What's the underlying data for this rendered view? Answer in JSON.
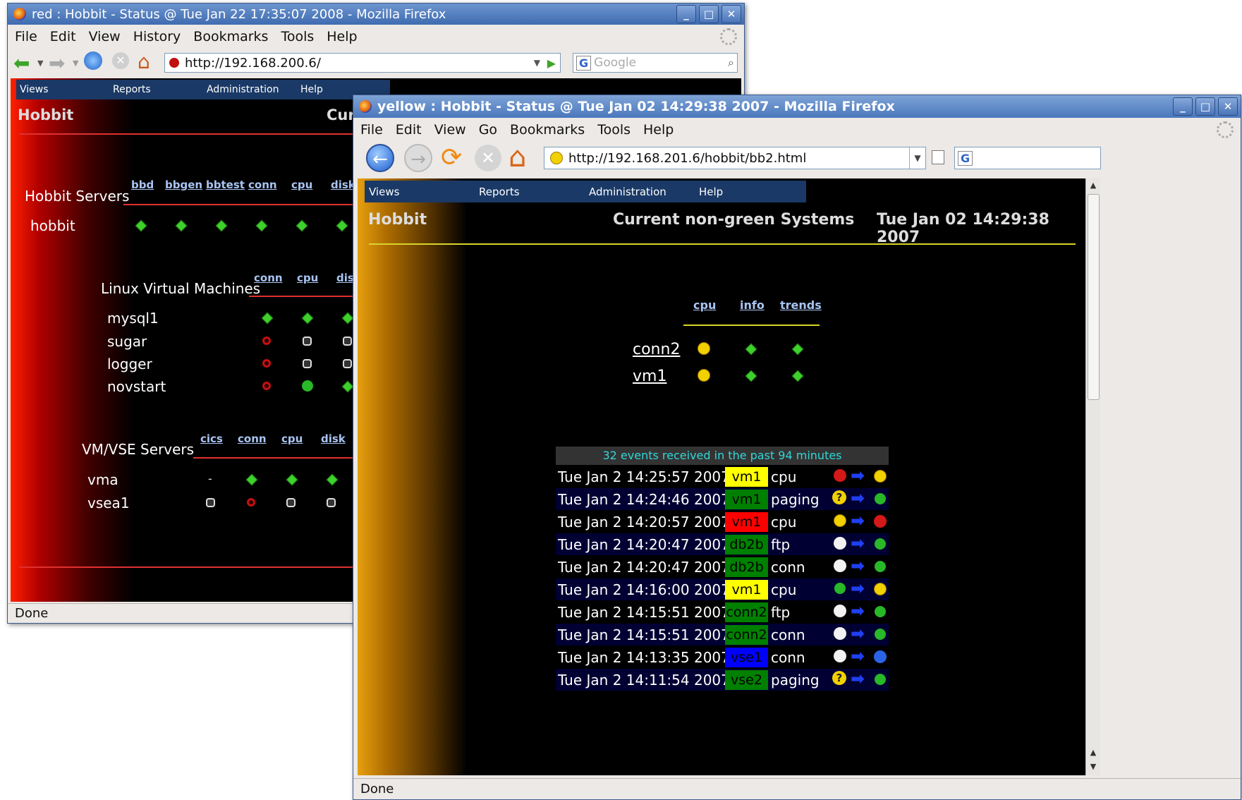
{
  "back_window": {
    "title": "red : Hobbit - Status @ Tue Jan 22 17:35:07 2008 - Mozilla Firefox",
    "menu": [
      "File",
      "Edit",
      "View",
      "History",
      "Bookmarks",
      "Tools",
      "Help"
    ],
    "url": "http://192.168.200.6/",
    "search_placeholder": "Google",
    "status": "Done",
    "page": {
      "menu": [
        "Views",
        "Reports",
        "Administration",
        "Help"
      ],
      "logo": "Hobbit",
      "title_partial": "Curr",
      "groups": [
        {
          "title": "Hobbit Servers",
          "columns": [
            "bbd",
            "bbgen",
            "bbtest",
            "conn",
            "cpu",
            "disk"
          ],
          "rows": [
            {
              "host": "hobbit",
              "states": [
                "green",
                "green",
                "green",
                "green",
                "green",
                "green"
              ]
            }
          ]
        },
        {
          "title": "Linux Virtual Machines",
          "columns": [
            "conn",
            "cpu",
            "disk"
          ],
          "rows": [
            {
              "host": "mysql1",
              "states": [
                "green",
                "green",
                "green"
              ]
            },
            {
              "host": "sugar",
              "states": [
                "red",
                "clear",
                "clear"
              ]
            },
            {
              "host": "logger",
              "states": [
                "red",
                "clear",
                "clear"
              ]
            },
            {
              "host": "novstart",
              "states": [
                "red",
                "green-face",
                "green"
              ]
            }
          ]
        },
        {
          "title": "VM/VSE Servers",
          "columns": [
            "cics",
            "conn",
            "cpu",
            "disk"
          ],
          "rows": [
            {
              "host": "vma",
              "states": [
                "-",
                "green",
                "green",
                "green"
              ]
            },
            {
              "host": "vsea1",
              "states": [
                "clear",
                "red",
                "clear",
                "clear"
              ]
            }
          ]
        }
      ]
    }
  },
  "front_window": {
    "title": "yellow : Hobbit - Status @ Tue Jan 02 14:29:38 2007 - Mozilla Firefox",
    "menu": [
      "File",
      "Edit",
      "View",
      "Go",
      "Bookmarks",
      "Tools",
      "Help"
    ],
    "url": "http://192.168.201.6/hobbit/bb2.html",
    "status": "Done",
    "page": {
      "menu": [
        "Views",
        "Reports",
        "Administration",
        "Help"
      ],
      "logo": "Hobbit",
      "page_title": "Current non-green Systems",
      "timestamp": "Tue Jan 02 14:29:38 2007",
      "columns": [
        "cpu",
        "info",
        "trends"
      ],
      "hosts": [
        {
          "name": "conn2",
          "states": [
            "yellow",
            "green",
            "green"
          ]
        },
        {
          "name": "vm1",
          "states": [
            "yellow",
            "green",
            "green"
          ]
        }
      ],
      "events_header": "32 events received in the past 94 minutes",
      "events": [
        {
          "time": "Tue Jan 2 14:25:57 2007",
          "host": "vm1",
          "host_color": "#ffff00",
          "host_text": "#000000",
          "test": "cpu",
          "from": "red",
          "to": "yellow"
        },
        {
          "time": "Tue Jan 2 14:24:46 2007",
          "host": "vm1",
          "host_color": "#008000",
          "host_text": "#000000",
          "test": "paging",
          "from": "purple",
          "to": "green"
        },
        {
          "time": "Tue Jan 2 14:20:57 2007",
          "host": "vm1",
          "host_color": "#ff0000",
          "host_text": "#000000",
          "test": "cpu",
          "from": "yellow",
          "to": "red"
        },
        {
          "time": "Tue Jan 2 14:20:47 2007",
          "host": "db2b",
          "host_color": "#008000",
          "host_text": "#000000",
          "test": "ftp",
          "from": "clear",
          "to": "green"
        },
        {
          "time": "Tue Jan 2 14:20:47 2007",
          "host": "db2b",
          "host_color": "#008000",
          "host_text": "#000000",
          "test": "conn",
          "from": "clear",
          "to": "green"
        },
        {
          "time": "Tue Jan 2 14:16:00 2007",
          "host": "vm1",
          "host_color": "#ffff00",
          "host_text": "#000000",
          "test": "cpu",
          "from": "green",
          "to": "yellow"
        },
        {
          "time": "Tue Jan 2 14:15:51 2007",
          "host": "conn2",
          "host_color": "#008000",
          "host_text": "#000000",
          "test": "ftp",
          "from": "clear",
          "to": "green"
        },
        {
          "time": "Tue Jan 2 14:15:51 2007",
          "host": "conn2",
          "host_color": "#008000",
          "host_text": "#000000",
          "test": "conn",
          "from": "clear",
          "to": "green"
        },
        {
          "time": "Tue Jan 2 14:13:35 2007",
          "host": "vse1",
          "host_color": "#0000ff",
          "host_text": "#000000",
          "test": "conn",
          "from": "clear",
          "to": "blue"
        },
        {
          "time": "Tue Jan 2 14:11:54 2007",
          "host": "vse2",
          "host_color": "#008000",
          "host_text": "#000000",
          "test": "paging",
          "from": "purple",
          "to": "green"
        }
      ]
    }
  }
}
